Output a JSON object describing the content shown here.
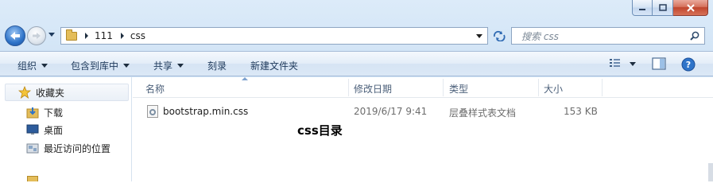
{
  "window": {
    "caption_buttons": [
      "minimize",
      "maximize",
      "close"
    ]
  },
  "navigation": {
    "breadcrumb": [
      "111",
      "css"
    ],
    "search_placeholder": "搜索 css"
  },
  "commands": {
    "organize": "组织",
    "include_in_library": "包含到库中",
    "share": "共享",
    "burn": "刻录",
    "new_folder": "新建文件夹"
  },
  "sidebar": {
    "items": [
      {
        "label": "收藏夹",
        "icon": "star-icon"
      },
      {
        "label": "下载",
        "icon": "download-folder-icon"
      },
      {
        "label": "桌面",
        "icon": "desktop-icon"
      },
      {
        "label": "最近访问的位置",
        "icon": "recent-places-icon"
      }
    ]
  },
  "columns": {
    "name": "名称",
    "date_modified": "修改日期",
    "type": "类型",
    "size": "大小"
  },
  "files": [
    {
      "name": "bootstrap.min.css",
      "date_modified": "2019/6/17 9:41",
      "type": "层叠样式表文档",
      "size": "153 KB"
    }
  ],
  "annotation": "css目录",
  "colors": {
    "accent": "#2f74c9",
    "close_red": "#c0452d",
    "chrome": "#cfe2f5"
  }
}
